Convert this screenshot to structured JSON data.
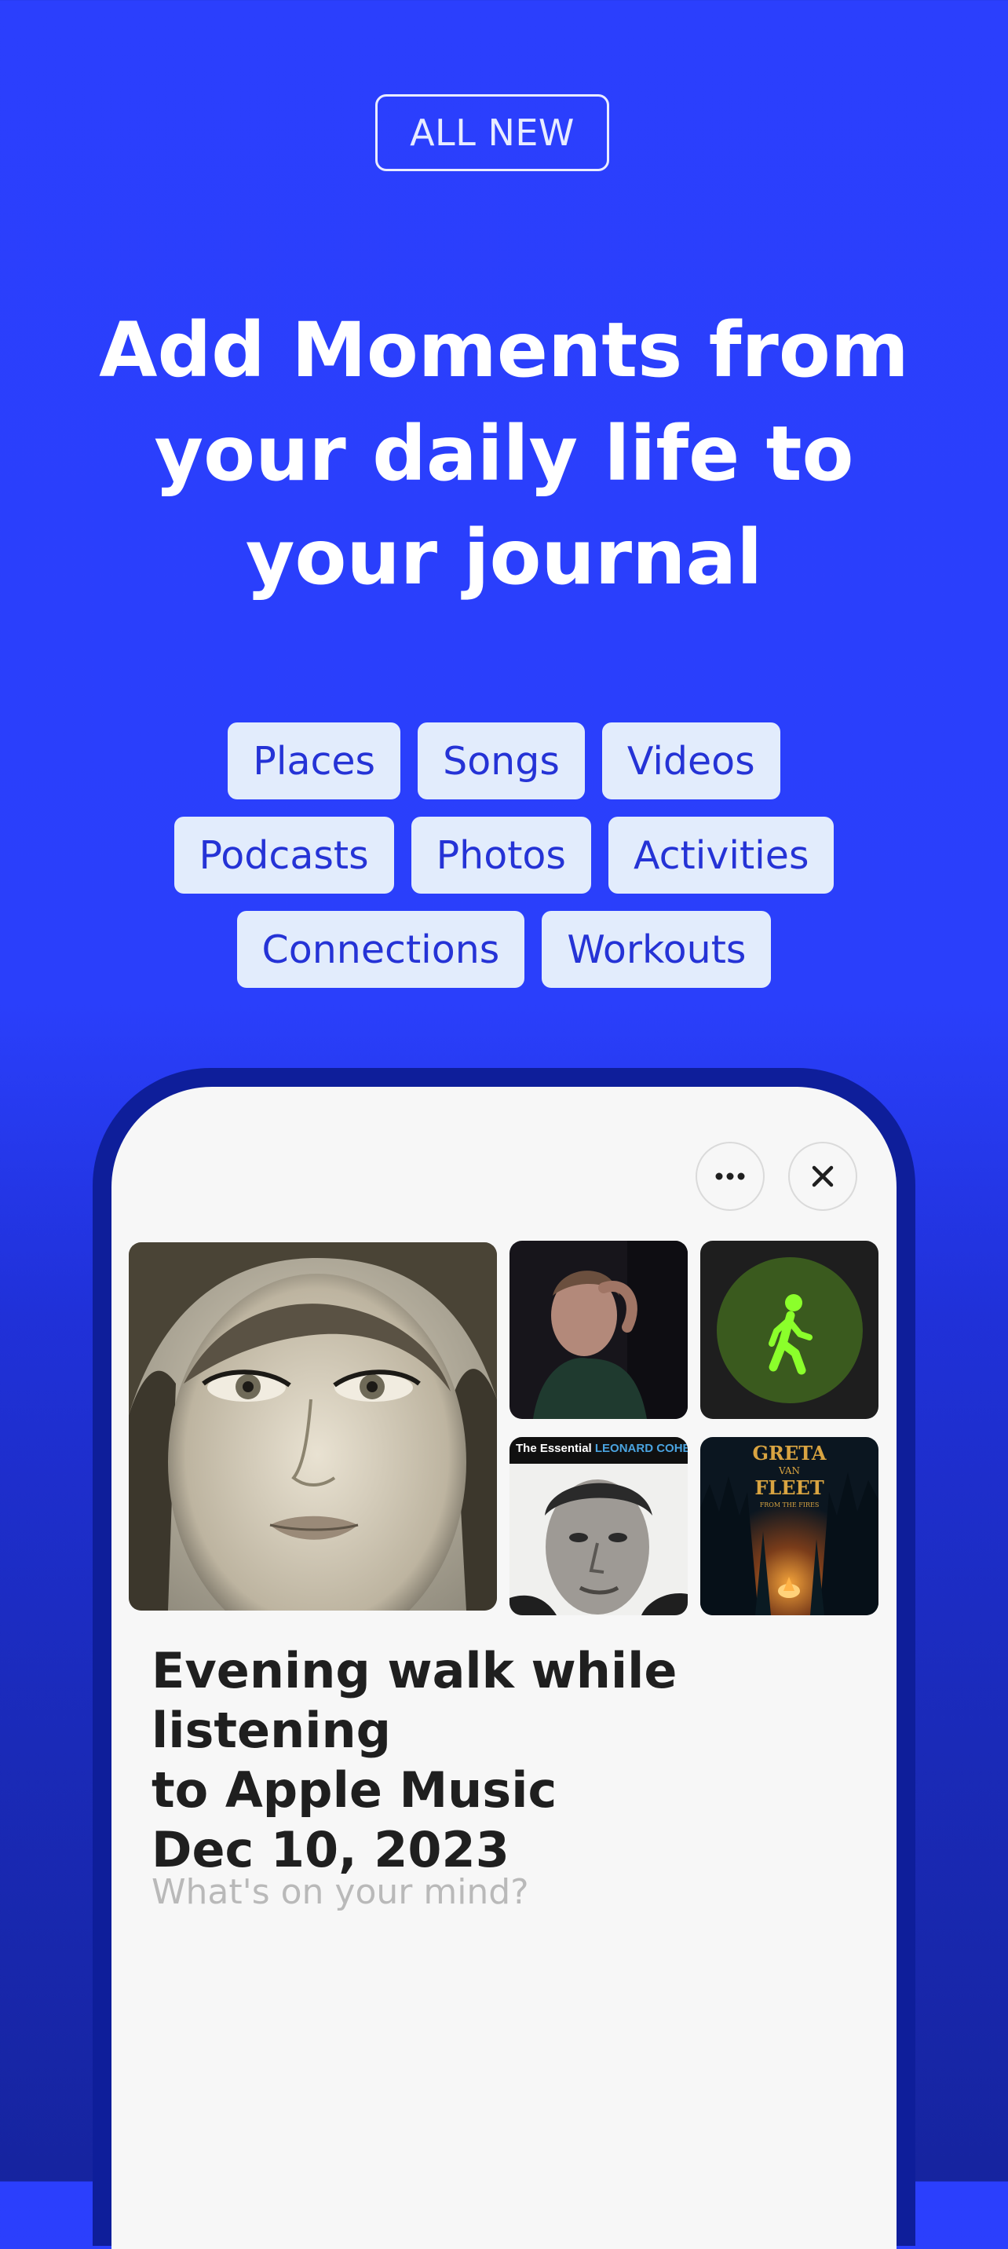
{
  "badge": {
    "label": "ALL NEW"
  },
  "headline": {
    "lines": [
      "Add Moments from",
      "your daily life to",
      "your journal"
    ]
  },
  "moment_types": [
    [
      "Places",
      "Songs",
      "Videos"
    ],
    [
      "Podcasts",
      "Photos",
      "Activities"
    ],
    [
      "Connections",
      "Workouts"
    ]
  ],
  "card": {
    "more_icon": "more-horizontal-icon",
    "close_icon": "close-icon",
    "album_covers": {
      "cover_small_2_text": "The Essential",
      "cover_small_2_artist": "LEONARD COHEN",
      "cover_small_4_text_1": "GRETA",
      "cover_small_4_text_2": "VAN",
      "cover_small_4_text_3": "FLEET",
      "cover_small_4_text_4": "FROM THE FIRES"
    },
    "activity_icon": "walking-person-icon",
    "title_lines": [
      "Evening walk while listening",
      "to Apple Music",
      "Dec 10, 2023"
    ],
    "prompt_placeholder": "What's on your mind?"
  },
  "colors": {
    "background": "#2b3ffd",
    "chip_bg": "#e2ecfc",
    "chip_text": "#2533d6",
    "activity_green": "#8bff2b"
  }
}
